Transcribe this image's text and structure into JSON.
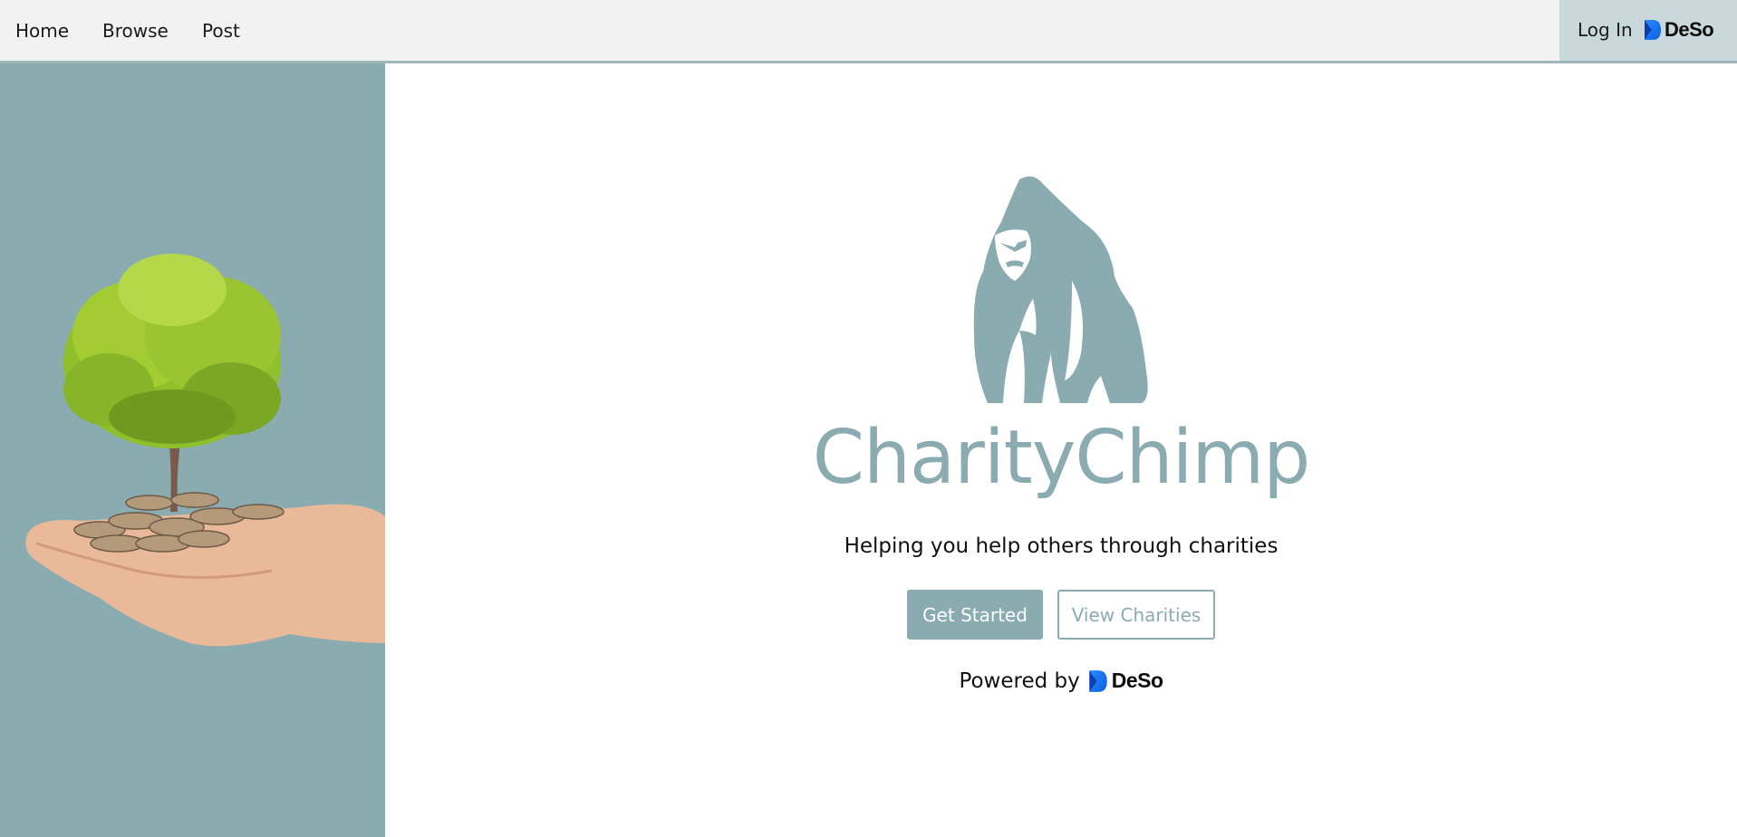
{
  "nav": {
    "links": [
      {
        "label": "Home"
      },
      {
        "label": "Browse"
      },
      {
        "label": "Post"
      }
    ],
    "login_label": "Log In",
    "deso_brand": "DeSo"
  },
  "hero": {
    "title": "CharityChimp",
    "tagline": "Helping you help others through charities",
    "primary_button": "Get Started",
    "secondary_button": "View Charities",
    "powered_by_label": "Powered by",
    "powered_brand": "DeSo"
  },
  "colors": {
    "accent": "#8aabb0",
    "nav_bg": "#f2f2f2",
    "login_bg": "#c9d8db",
    "deso_blue": "#1e7cf2"
  },
  "icons": {
    "logo": "gorilla-icon",
    "deso": "deso-icon",
    "hero_image": "tree-on-coins-in-hand"
  }
}
